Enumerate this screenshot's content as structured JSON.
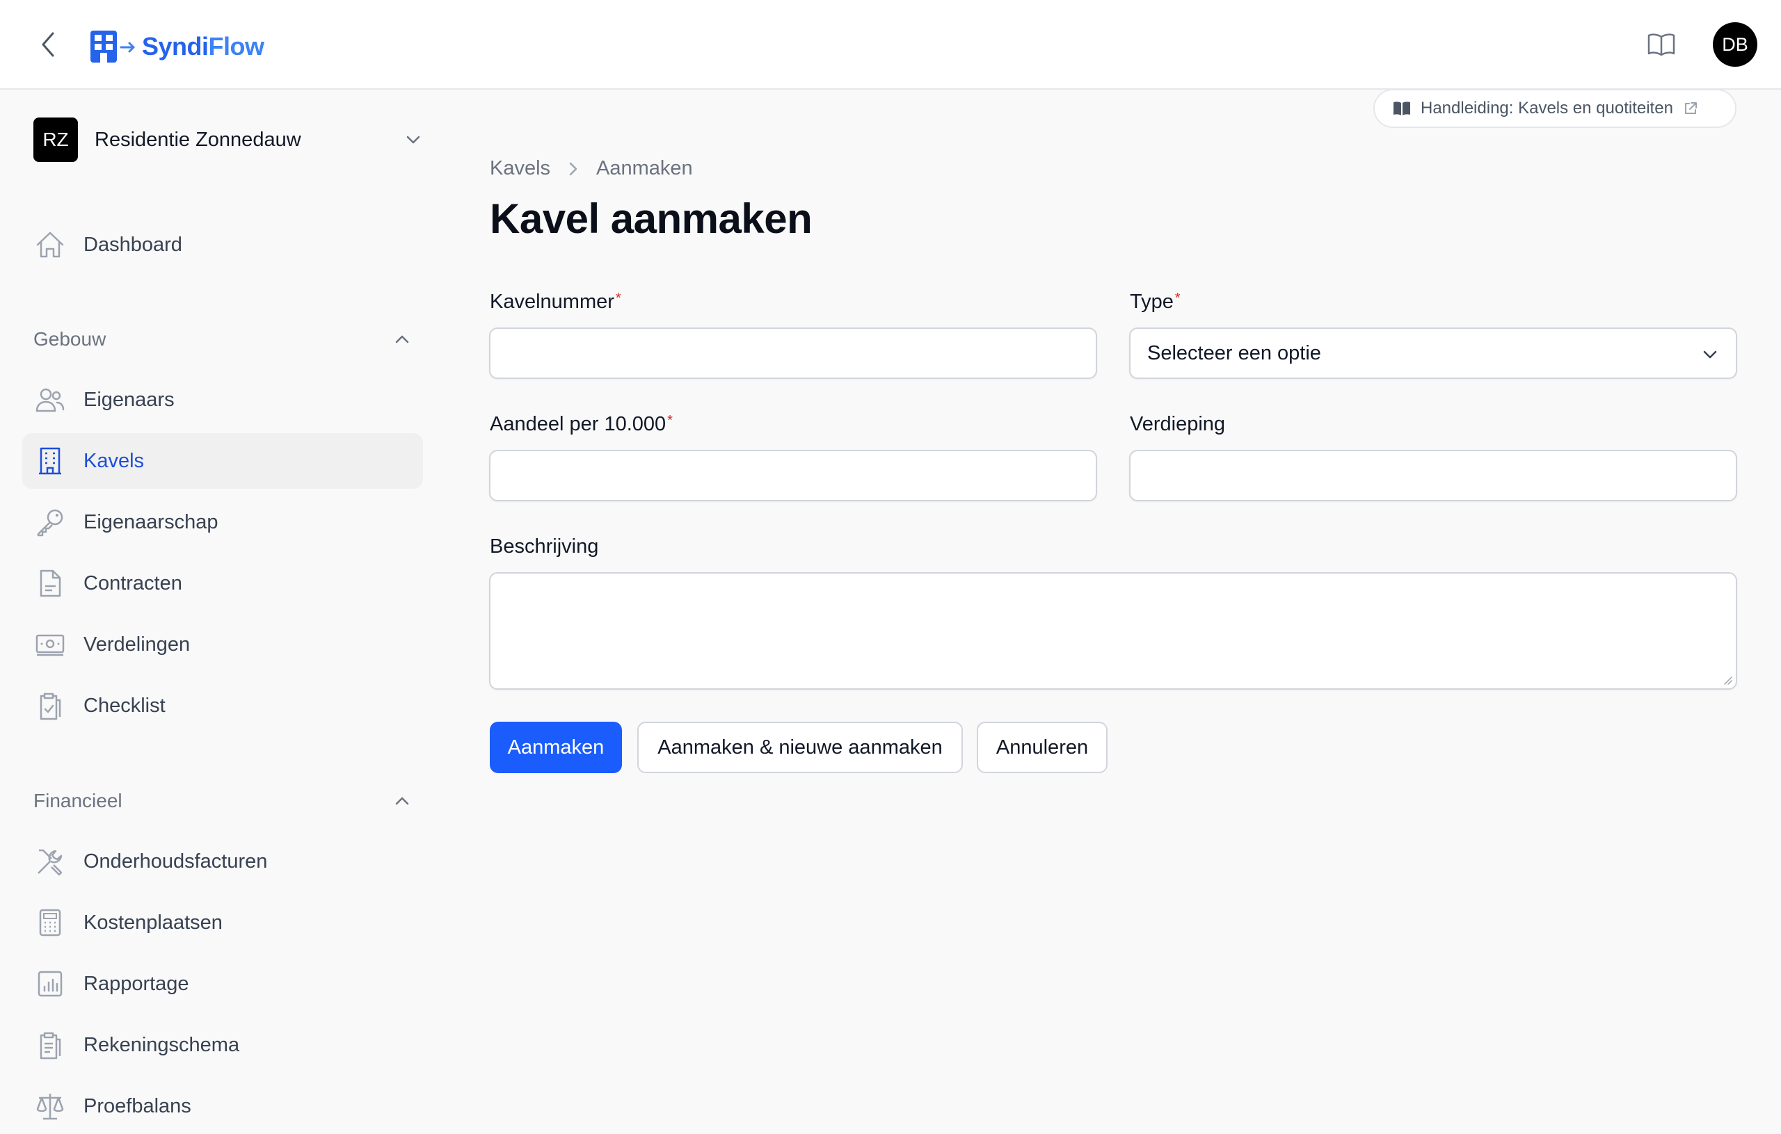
{
  "app": {
    "logo_part1": "Syndi",
    "logo_part2": "Flow",
    "avatar_initials": "DB",
    "accent": "#2563eb"
  },
  "tenant": {
    "initials": "RZ",
    "name": "Residentie Zonnedauw"
  },
  "sidebar": {
    "dashboard": {
      "label": "Dashboard",
      "icon": "home-icon"
    },
    "groups": [
      {
        "title": "Gebouw",
        "items": [
          {
            "label": "Eigenaars",
            "icon": "users-icon"
          },
          {
            "label": "Kavels",
            "icon": "building-icon",
            "active": true
          },
          {
            "label": "Eigenaarschap",
            "icon": "key-icon"
          },
          {
            "label": "Contracten",
            "icon": "document-icon"
          },
          {
            "label": "Verdelingen",
            "icon": "banknote-icon"
          },
          {
            "label": "Checklist",
            "icon": "clipboard-check-icon"
          }
        ]
      },
      {
        "title": "Financieel",
        "items": [
          {
            "label": "Onderhoudsfacturen",
            "icon": "wrench-screwdriver-icon"
          },
          {
            "label": "Kostenplaatsen",
            "icon": "calculator-icon"
          },
          {
            "label": "Rapportage",
            "icon": "chart-bar-icon"
          },
          {
            "label": "Rekeningschema",
            "icon": "clipboard-list-icon"
          },
          {
            "label": "Proefbalans",
            "icon": "scale-icon"
          }
        ]
      }
    ]
  },
  "manual": {
    "label": "Handleiding: Kavels en quotiteiten"
  },
  "breadcrumb": {
    "parent": "Kavels",
    "current": "Aanmaken"
  },
  "page": {
    "title": "Kavel aanmaken"
  },
  "form": {
    "kavelnummer": {
      "label": "Kavelnummer",
      "value": ""
    },
    "type": {
      "label": "Type",
      "value": "Selecteer een optie"
    },
    "aandeel": {
      "label": "Aandeel per 10.000",
      "value": ""
    },
    "verdieping": {
      "label": "Verdieping",
      "value": ""
    },
    "beschrijving": {
      "label": "Beschrijving",
      "value": ""
    },
    "required_mark": "*"
  },
  "actions": {
    "create": "Aanmaken",
    "create_another": "Aanmaken & nieuwe aanmaken",
    "cancel": "Annuleren"
  }
}
